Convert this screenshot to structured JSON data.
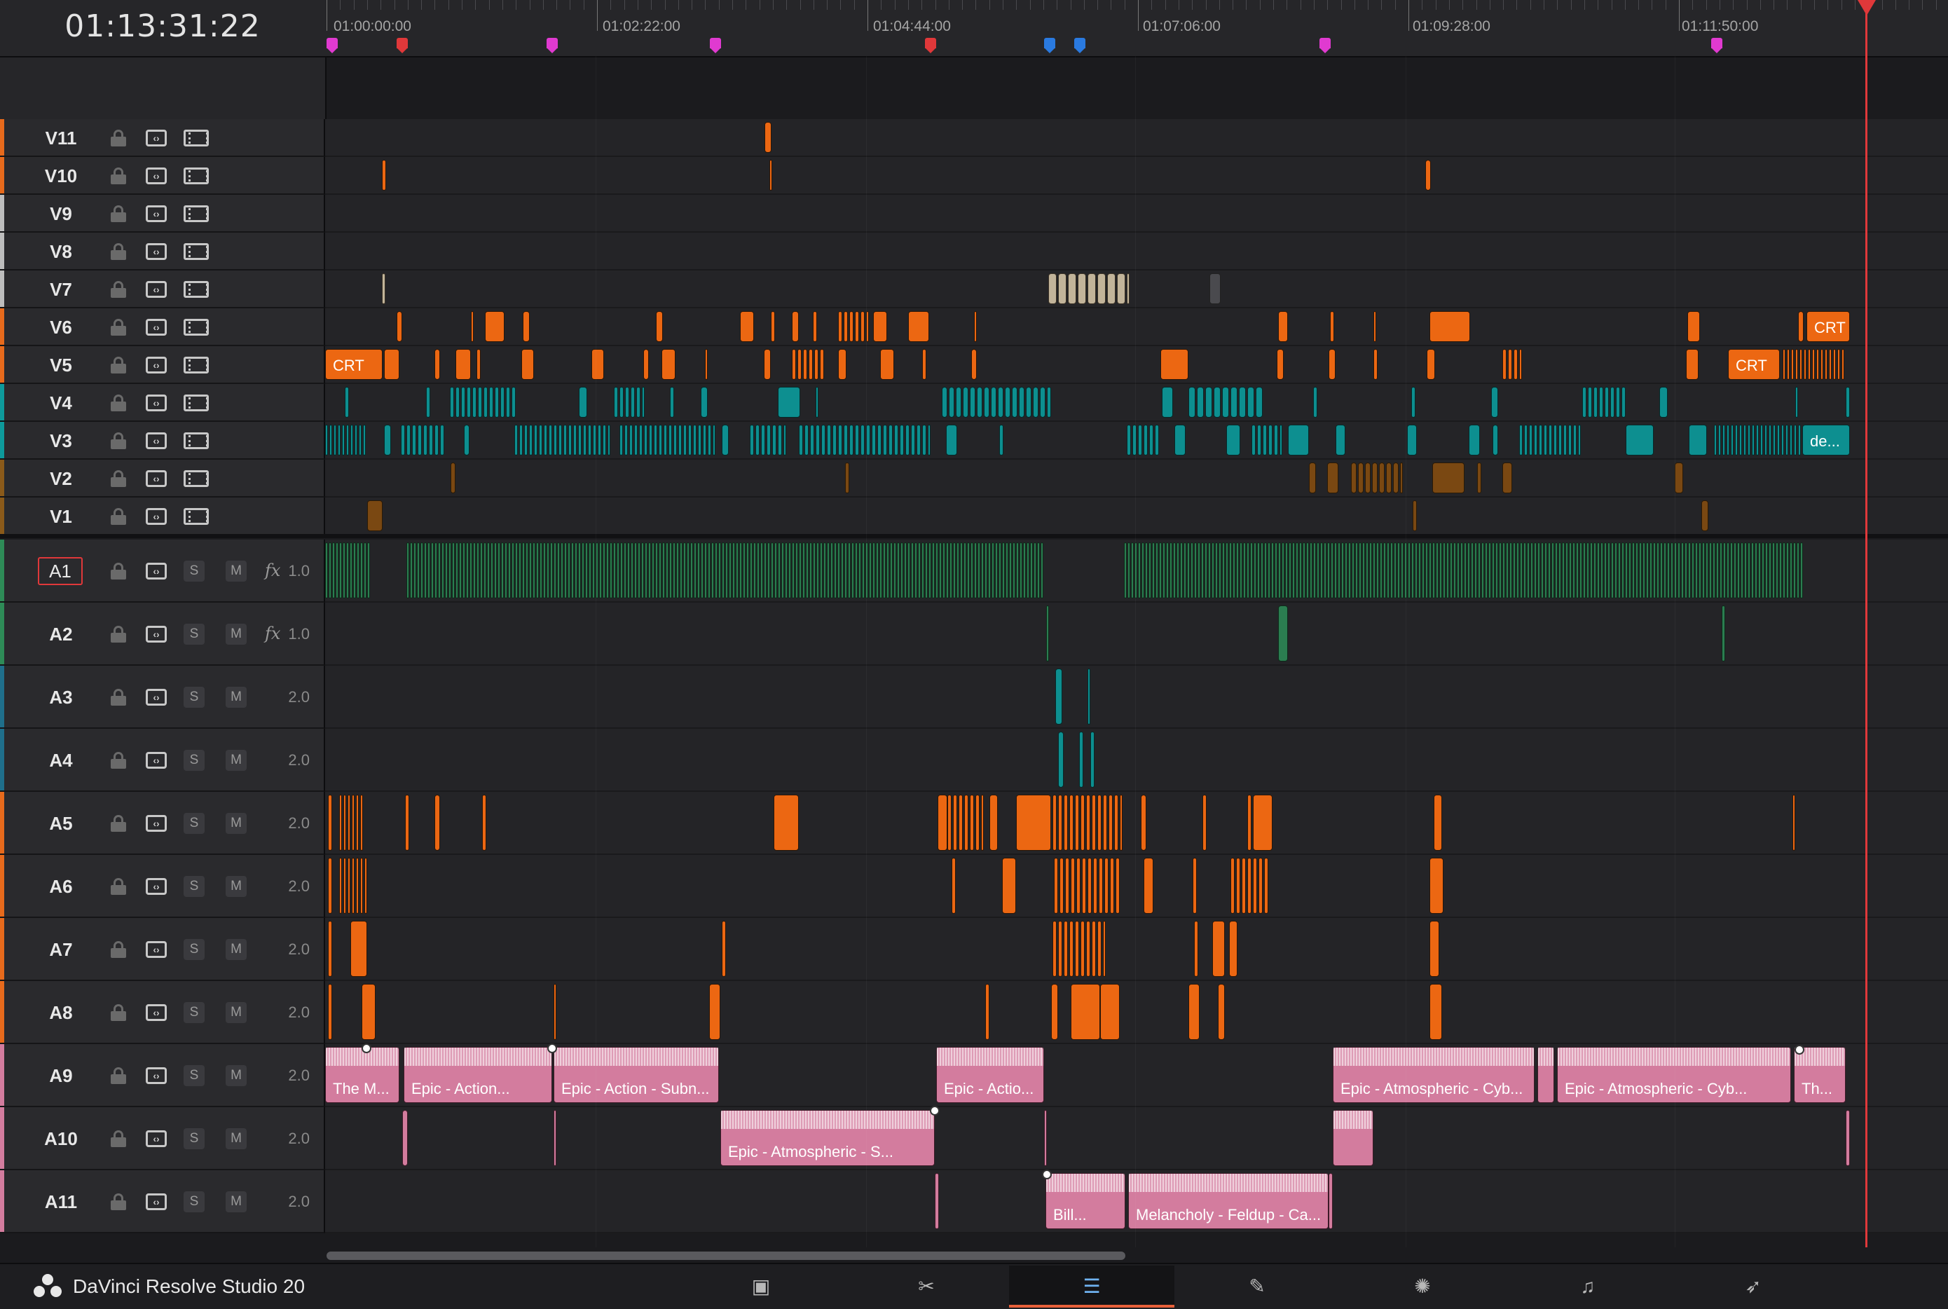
{
  "timeline": {
    "current_timecode": "01:13:31:22",
    "ruler_labels": [
      "01:00:00:00",
      "01:02:22:00",
      "01:04:44:00",
      "01:07:06:00",
      "01:09:28:00",
      "01:11:50:00"
    ]
  },
  "video_tracks": [
    {
      "name": "V11",
      "color": "#e76a1c"
    },
    {
      "name": "V10",
      "color": "#e76a1c"
    },
    {
      "name": "V9",
      "color": "#bdbdbd"
    },
    {
      "name": "V8",
      "color": "#bdbdbd"
    },
    {
      "name": "V7",
      "color": "#bdbdbd"
    },
    {
      "name": "V6",
      "color": "#e76a1c"
    },
    {
      "name": "V5",
      "color": "#e76a1c"
    },
    {
      "name": "V4",
      "color": "#0e9a9b"
    },
    {
      "name": "V3",
      "color": "#0e9a9b"
    },
    {
      "name": "V2",
      "color": "#8a5a1a"
    },
    {
      "name": "V1",
      "color": "#8a5a1a"
    }
  ],
  "audio_tracks": [
    {
      "name": "A1",
      "fx": "fx",
      "channels": "1.0",
      "color": "#2e8b57",
      "solo": "S",
      "mute": "M"
    },
    {
      "name": "A2",
      "fx": "fx",
      "channels": "1.0",
      "color": "#2e8b57",
      "solo": "S",
      "mute": "M"
    },
    {
      "name": "A3",
      "fx": "",
      "channels": "2.0",
      "color": "#1f6f8b",
      "solo": "S",
      "mute": "M"
    },
    {
      "name": "A4",
      "fx": "",
      "channels": "2.0",
      "color": "#1f6f8b",
      "solo": "S",
      "mute": "M"
    },
    {
      "name": "A5",
      "fx": "",
      "channels": "2.0",
      "color": "#e76a1c",
      "solo": "S",
      "mute": "M"
    },
    {
      "name": "A6",
      "fx": "",
      "channels": "2.0",
      "color": "#e76a1c",
      "solo": "S",
      "mute": "M"
    },
    {
      "name": "A7",
      "fx": "",
      "channels": "2.0",
      "color": "#e76a1c",
      "solo": "S",
      "mute": "M"
    },
    {
      "name": "A8",
      "fx": "",
      "channels": "2.0",
      "color": "#e76a1c",
      "solo": "S",
      "mute": "M"
    },
    {
      "name": "A9",
      "fx": "",
      "channels": "2.0",
      "color": "#d37c9e",
      "solo": "S",
      "mute": "M"
    },
    {
      "name": "A10",
      "fx": "",
      "channels": "2.0",
      "color": "#d37c9e",
      "solo": "S",
      "mute": "M"
    },
    {
      "name": "A11",
      "fx": "",
      "channels": "2.0",
      "color": "#d37c9e",
      "solo": "S",
      "mute": "M"
    }
  ],
  "clip_labels": {
    "v6_crt": "CRT",
    "v5_crt_left": "CRT",
    "v5_crt_right": "CRT",
    "v3_de": "de...",
    "a9_1": "The M...",
    "a9_2": "Epic - Action...",
    "a9_3": "Epic - Action - Subn...",
    "a9_4": "Epic - Actio...",
    "a9_5": "Epic - Atmospheric - Cyb...",
    "a9_6": "Epic - Atmospheric - Cyb...",
    "a9_7": "Th...",
    "a10_1": "Epic - Atmospheric - S...",
    "a11_1": "Bill...",
    "a11_2": "Melancholy - Feldup - Ca..."
  },
  "colors": {
    "orange": "#ec6712",
    "teal": "#0d8f90",
    "brown": "#7a4812",
    "green": "#2b7d50",
    "pink": "#d37c9e",
    "playhead": "#e0383a",
    "marker_magenta": "#e03ad0",
    "marker_red": "#e0383a",
    "marker_blue": "#2a7ae0"
  },
  "footer": {
    "brand": "DaVinci Resolve Studio 20",
    "pages": [
      {
        "name": "media-page",
        "icon": "media-icon",
        "glyph": "▣"
      },
      {
        "name": "cut-page",
        "icon": "cut-icon",
        "glyph": "✂"
      },
      {
        "name": "edit-page",
        "icon": "edit-icon",
        "glyph": "☰"
      },
      {
        "name": "fusion-page",
        "icon": "fusion-icon",
        "glyph": "✎"
      },
      {
        "name": "color-page",
        "icon": "color-icon",
        "glyph": "✺"
      },
      {
        "name": "fairlight-page",
        "icon": "fairlight-icon",
        "glyph": "♫"
      },
      {
        "name": "deliver-page",
        "icon": "deliver-icon",
        "glyph": "➶"
      }
    ],
    "active_page": "edit-page"
  }
}
